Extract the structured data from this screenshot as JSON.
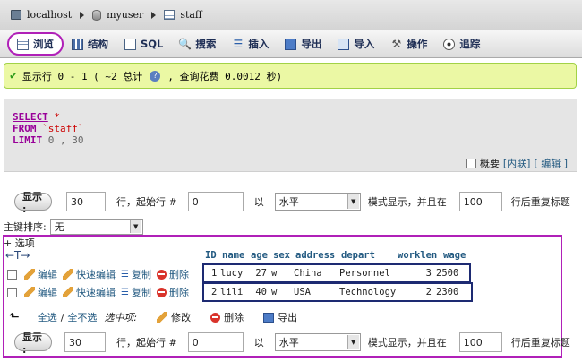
{
  "breadcrumb": {
    "server": "localhost",
    "database": "myuser",
    "table": "staff"
  },
  "tabs": [
    {
      "label": "浏览",
      "icon": "browse-icon"
    },
    {
      "label": "结构",
      "icon": "structure-icon"
    },
    {
      "label": "SQL",
      "icon": "sql-icon"
    },
    {
      "label": "搜索",
      "icon": "search-icon"
    },
    {
      "label": "插入",
      "icon": "insert-icon"
    },
    {
      "label": "导出",
      "icon": "export-icon"
    },
    {
      "label": "导入",
      "icon": "import-icon"
    },
    {
      "label": "操作",
      "icon": "wrench-icon"
    },
    {
      "label": "追踪",
      "icon": "tracking-icon"
    }
  ],
  "message": {
    "prefix": "显示行 0 - 1 ( ~2 总计",
    "suffix": ", 查询花费 0.0012 秒)"
  },
  "sql": {
    "select": "SELECT",
    "star": " *",
    "from": "FROM",
    "table": " `staff`",
    "limit": "LIMIT",
    "limit_args": " 0 , 30"
  },
  "sql_links": {
    "profile": "概要",
    "inline": "[内联]",
    "edit": "[ 编辑 ]"
  },
  "nav_top": {
    "show_button": "显示 :",
    "rows": "30",
    "rows_label": "行，起始行 #",
    "start": "0",
    "mode_label": "以",
    "mode": "水平",
    "mode_suffix": "模式显示，并且在",
    "repeat": "100",
    "repeat_label": "行后重复标题"
  },
  "sort": {
    "label": "主键排序:",
    "value": "无"
  },
  "options_link": "+ 选项",
  "columns": [
    "ID",
    "name",
    "age",
    "sex",
    "address",
    "depart",
    "worklen",
    "wage"
  ],
  "row_actions": {
    "edit": "编辑",
    "quick_edit": "快速编辑",
    "copy": "复制",
    "delete": "删除"
  },
  "rows": [
    {
      "id": "1",
      "name": "lucy",
      "age": "27",
      "sex": "w",
      "address": "China",
      "depart": "Personnel",
      "worklen": "3",
      "wage": "2500"
    },
    {
      "id": "2",
      "name": "lili",
      "age": "40",
      "sex": "w",
      "address": "USA",
      "depart": "Technology",
      "worklen": "2",
      "wage": "2300"
    }
  ],
  "bulk": {
    "check_all": "全选",
    "sep": "/",
    "uncheck_all": "全不选",
    "with_selected": "选中项:",
    "change": "修改",
    "delete": "删除",
    "export": "导出"
  },
  "nav_bottom": {
    "show_button": "显示 :",
    "rows": "30",
    "rows_label": "行，起始行 #",
    "start": "0",
    "mode_label": "以",
    "mode": "水平",
    "mode_suffix": "模式显示，并且在",
    "repeat": "100",
    "repeat_label": "行后重复标题"
  }
}
